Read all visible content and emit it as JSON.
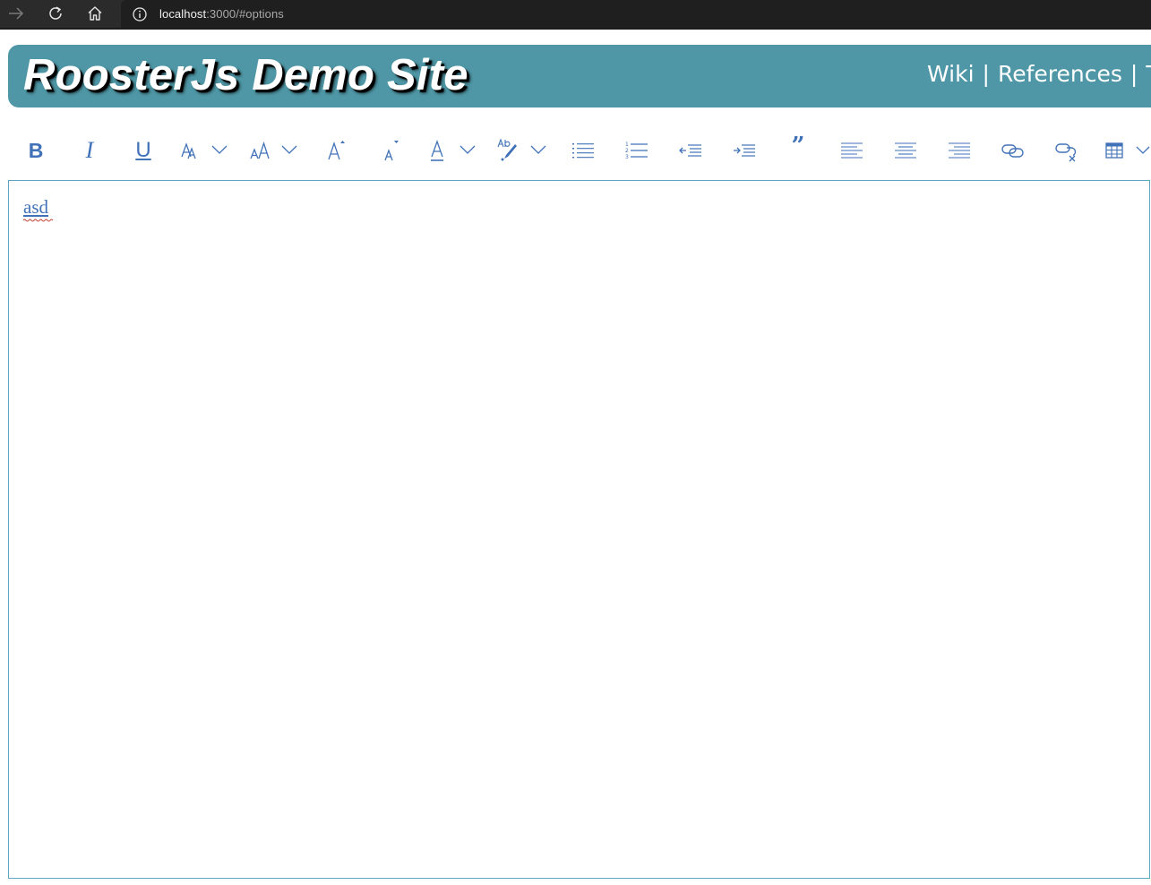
{
  "browser": {
    "url_host": "localhost",
    "url_path": ":3000/#options",
    "icons": [
      "forward-icon",
      "refresh-icon",
      "home-icon",
      "info-icon"
    ]
  },
  "header": {
    "title": "RoosterJs Demo Site",
    "links": [
      "Wiki",
      "References",
      "Te"
    ],
    "separator": "|",
    "banner_color": "#4f97a6"
  },
  "toolbar": {
    "color": "#4172b7",
    "buttons": [
      "bold",
      "italic",
      "underline",
      "font",
      "font-size",
      "increase-font-size",
      "decrease-font-size",
      "text-color",
      "background-color",
      "bullet-list",
      "numbered-list",
      "decrease-indent",
      "increase-indent",
      "quote",
      "align-left",
      "align-center",
      "align-right",
      "insert-link",
      "remove-link",
      "insert-table"
    ],
    "bold_label": "B",
    "italic_label": "I",
    "underline_label": "U",
    "quote_label": "”"
  },
  "editor": {
    "content": "asd",
    "border_color": "#5fa7c0"
  }
}
